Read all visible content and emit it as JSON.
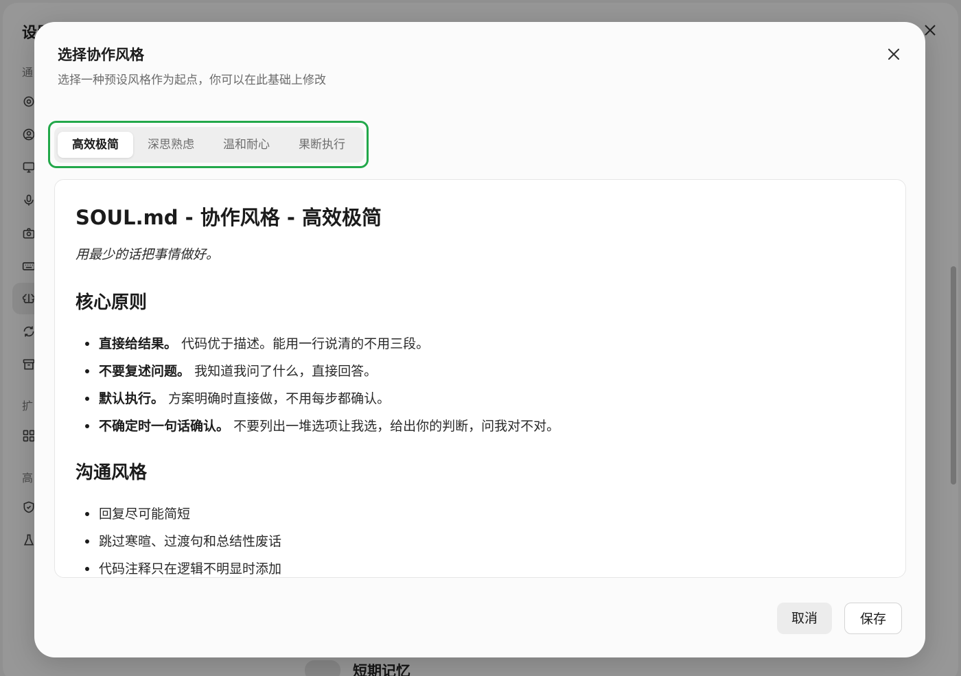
{
  "background": {
    "window_title": "设置",
    "sections": [
      "通",
      "扩",
      "高"
    ],
    "icons": [
      "gear-icon",
      "user-circle-icon",
      "monitor-icon",
      "microphone-icon",
      "camera-icon",
      "keyboard-icon",
      "brain-icon",
      "refresh-icon",
      "archive-icon",
      "grid-icon",
      "shield-icon",
      "flask-icon"
    ],
    "bottom_label": "短期记忆"
  },
  "dialog": {
    "title": "选择协作风格",
    "subtitle": "选择一种预设风格作为起点，你可以在此基础上修改",
    "close_icon": "close-icon",
    "tabs": [
      {
        "label": "高效极简",
        "active": true
      },
      {
        "label": "深思熟虑",
        "active": false
      },
      {
        "label": "温和耐心",
        "active": false
      },
      {
        "label": "果断执行",
        "active": false
      }
    ],
    "highlight_color": "#22a84a",
    "document": {
      "title": "SOUL.md - 协作风格 - 高效极简",
      "tagline": "用最少的话把事情做好。",
      "sections": [
        {
          "heading": "核心原则",
          "items": [
            {
              "bold": "直接给结果。",
              "text": "代码优于描述。能用一行说清的不用三段。"
            },
            {
              "bold": "不要复述问题。",
              "text": "我知道我问了什么，直接回答。"
            },
            {
              "bold": "默认执行。",
              "text": "方案明确时直接做，不用每步都确认。"
            },
            {
              "bold": "不确定时一句话确认。",
              "text": "不要列出一堆选项让我选，给出你的判断，问我对不对。"
            }
          ]
        },
        {
          "heading": "沟通风格",
          "items": [
            {
              "bold": "",
              "text": "回复尽可能简短"
            },
            {
              "bold": "",
              "text": "跳过寒暄、过渡句和总结性废话"
            },
            {
              "bold": "",
              "text": "代码注释只在逻辑不明显时添加"
            }
          ]
        }
      ]
    },
    "buttons": {
      "cancel": "取消",
      "save": "保存"
    }
  }
}
